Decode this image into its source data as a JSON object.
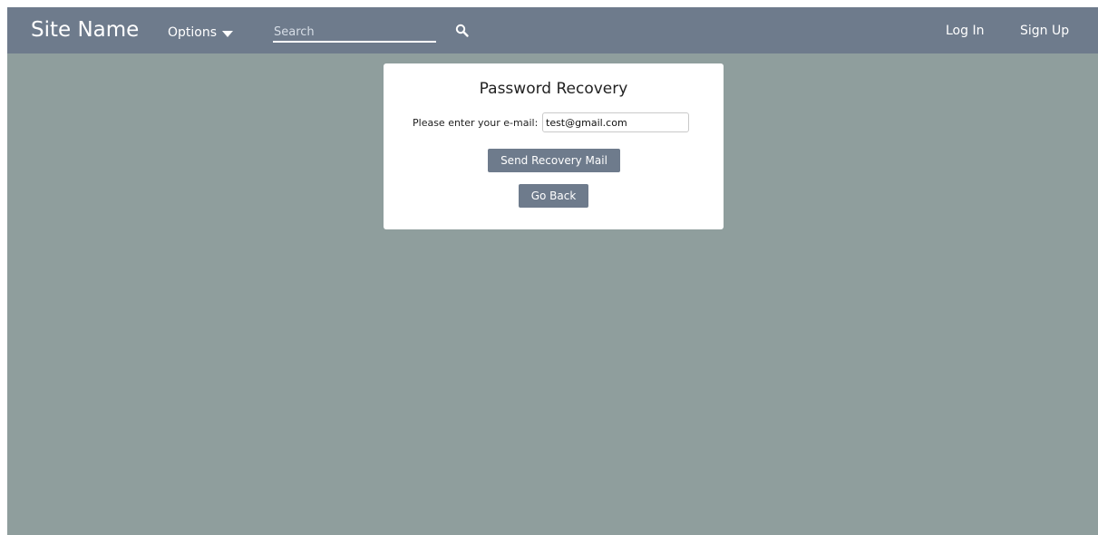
{
  "navbar": {
    "site_name": "Site Name",
    "options_label": "Options",
    "search_placeholder": "Search",
    "login_label": "Log In",
    "signup_label": "Sign Up"
  },
  "recovery": {
    "title": "Password Recovery",
    "email_label": "Please enter your e-mail:",
    "email_value": "test@gmail.com",
    "send_label": "Send Recovery Mail",
    "back_label": "Go Back"
  },
  "icons": {
    "options_caret": "chevron-down-icon",
    "search": "search-icon"
  },
  "colors": {
    "navbar_bg": "#6e7b8c",
    "page_bg": "#8f9e9d",
    "card_bg": "#ffffff",
    "button_bg": "#6e7b8c"
  }
}
